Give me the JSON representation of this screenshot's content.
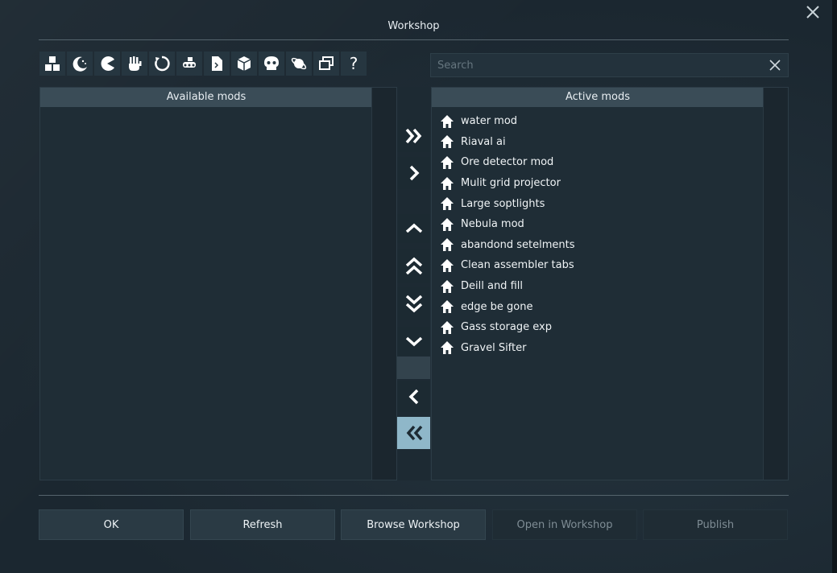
{
  "window": {
    "title": "Workshop"
  },
  "toolbar": {
    "icons": [
      "blocks-icon",
      "moon-icon",
      "pacman-icon",
      "hand-icon",
      "refresh-icon",
      "conveyor-icon",
      "script-file-icon",
      "cube-icon",
      "skull-icon",
      "planet-icon",
      "windows-icon",
      "help-icon"
    ],
    "help_glyph": "?"
  },
  "search": {
    "placeholder": "Search",
    "value": ""
  },
  "available": {
    "header": "Available mods",
    "items": []
  },
  "active": {
    "header": "Active mods",
    "items": [
      "water mod",
      "Riaval ai",
      "Ore detector mod",
      "Mulit grid projector",
      "Large soptlights",
      "Nebula mod",
      "abandond setelments",
      "Clean assembler tabs",
      "Deill and fill",
      "edge be gone",
      "Gass storage exp",
      "Gravel Sifter"
    ]
  },
  "buttons": {
    "ok": "OK",
    "refresh": "Refresh",
    "browse": "Browse Workshop",
    "open": "Open in Workshop",
    "publish": "Publish"
  },
  "colors": {
    "accent": "#8fb7c9",
    "panel_header": "#3a4c57",
    "background": "#1d2a33"
  }
}
